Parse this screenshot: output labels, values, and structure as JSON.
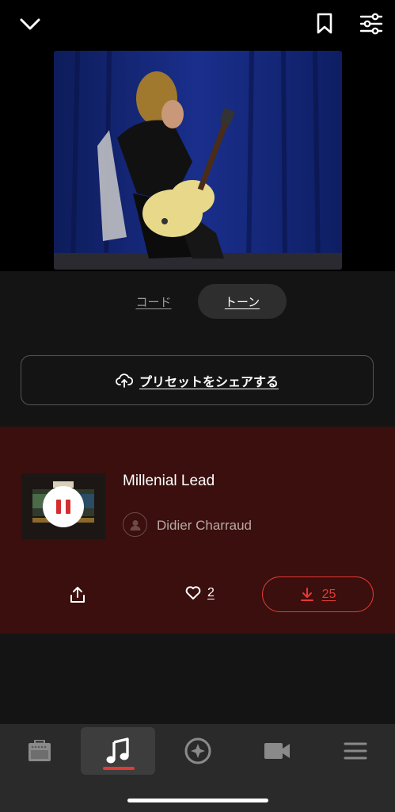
{
  "header": {
    "collapse_icon": "chevron-down-icon",
    "bookmark_icon": "bookmark-icon",
    "settings_icon": "sliders-icon"
  },
  "video": {
    "description_icon": "video-thumbnail"
  },
  "tabs": [
    {
      "label": "コード",
      "active": false
    },
    {
      "label": "トーン",
      "active": true
    }
  ],
  "share_preset": {
    "label": "プリセットをシェアする",
    "icon": "cloud-upload-icon"
  },
  "preset": {
    "name": "Millenial Lead",
    "author": "Didier Charraud",
    "likes": "2",
    "downloads": "25",
    "playing": true
  },
  "nav": [
    {
      "icon": "amp-icon",
      "active": false
    },
    {
      "icon": "music-note-icon",
      "active": true
    },
    {
      "icon": "compass-icon",
      "active": false
    },
    {
      "icon": "video-camera-icon",
      "active": false
    },
    {
      "icon": "menu-icon",
      "active": false
    }
  ],
  "colors": {
    "accent": "#e53935",
    "card_bg": "#3a0f0d",
    "page_bg": "#141414"
  }
}
